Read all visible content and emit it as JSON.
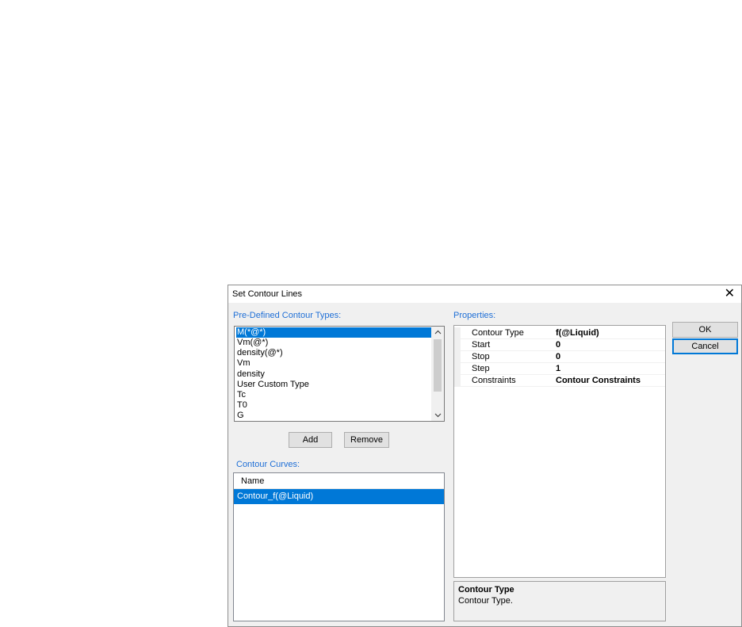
{
  "dialog": {
    "title": "Set Contour Lines",
    "close_label": "✕"
  },
  "predefined": {
    "label": "Pre-Defined Contour Types:",
    "items": [
      "M(*@*)",
      "Vm(@*)",
      "density(@*)",
      "Vm",
      "density",
      "User Custom Type",
      "Tc",
      "T0",
      "G"
    ],
    "selected_index": 0,
    "add_label": "Add",
    "remove_label": "Remove"
  },
  "curves": {
    "label": "Contour Curves:",
    "column_header": "Name",
    "rows": [
      "Contour_f(@Liquid)"
    ]
  },
  "properties": {
    "label": "Properties:",
    "rows": [
      {
        "name": "Contour Type",
        "value": "f(@Liquid)"
      },
      {
        "name": "Start",
        "value": "0"
      },
      {
        "name": "Stop",
        "value": "0"
      },
      {
        "name": "Step",
        "value": "1"
      },
      {
        "name": "Constraints",
        "value": "Contour Constraints"
      }
    ],
    "description_title": "Contour Type",
    "description_text": "Contour Type."
  },
  "buttons": {
    "ok": "OK",
    "cancel": "Cancel"
  },
  "colors": {
    "accent": "#0078d7",
    "section_label": "#1f6fd6"
  }
}
